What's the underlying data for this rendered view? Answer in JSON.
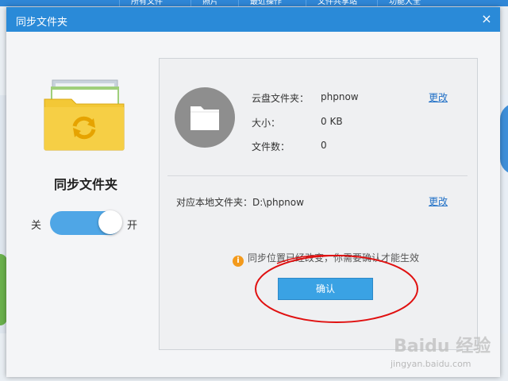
{
  "background": {
    "tabs": [
      "所有文件",
      "照片",
      "最近操作",
      "文件共享站",
      "功能大全"
    ]
  },
  "dialog": {
    "title": "同步文件夹",
    "close_glyph": "×"
  },
  "left": {
    "title": "同步文件夹",
    "toggle_off_label": "关",
    "toggle_on_label": "开",
    "toggle_state": "on"
  },
  "panel": {
    "cloud_folder_label": "云盘文件夹：",
    "cloud_folder_value": "phpnow",
    "size_label": "大小：",
    "size_value": "0 KB",
    "file_count_label": "文件数：",
    "file_count_value": "0",
    "change_link": "更改",
    "local_folder_label": "对应本地文件夹：",
    "local_folder_value": "D:\\phpnow",
    "local_change_link": "更改",
    "notice_text": "同步位置已经改变，你需要确认才能生效",
    "confirm_button": "确认"
  },
  "watermark": {
    "text": "Baidu 经验",
    "sub": "jingyan.baidu.com"
  },
  "colors": {
    "titlebar": "#2a8ad8",
    "toggle": "#4fa6e6",
    "confirm": "#3aa2e4",
    "link": "#1f6fc6",
    "annotation": "#e01010"
  },
  "icons": {
    "folder": "sync-folder-icon",
    "cloud_folder": "folder-icon",
    "info": "info-icon",
    "close": "close-icon"
  }
}
